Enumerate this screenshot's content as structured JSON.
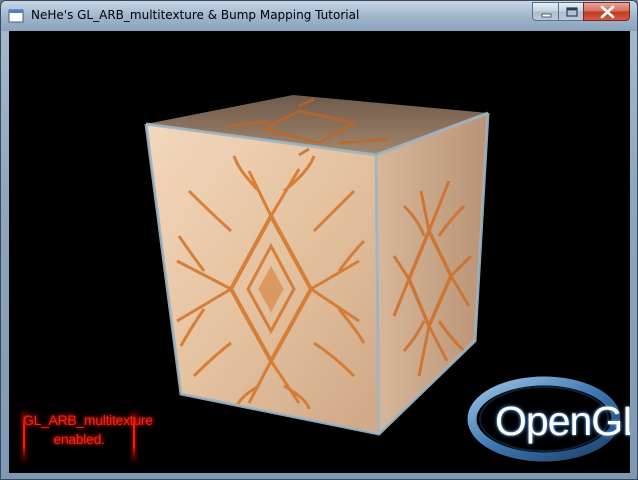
{
  "window": {
    "title": "NeHe's GL_ARB_multitexture & Bump Mapping Tutorial",
    "icon": "app-window-icon",
    "controls": {
      "minimize": "minimize-icon",
      "maximize": "maximize-icon",
      "close": "close-icon"
    }
  },
  "scene": {
    "object": "textured-cube",
    "background_color": "#000000",
    "texture_color": "#d4782e",
    "status_lines": [
      "GL_ARB_multitexture",
      "enabled."
    ],
    "status_color": "#e02a1d",
    "logo_text": "OpenGL",
    "logo_color": "#6f9ec8"
  }
}
